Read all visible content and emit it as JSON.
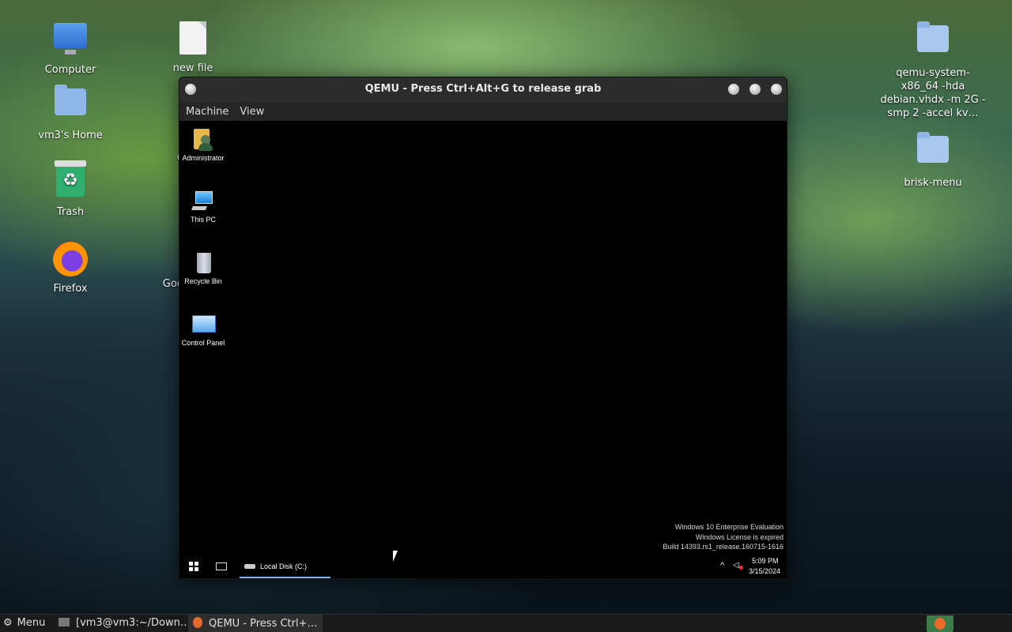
{
  "desktop": {
    "icons_left": [
      {
        "label": "Computer",
        "icon": "computer-icon"
      },
      {
        "label": "vm3's Home",
        "icon": "home-folder-icon"
      },
      {
        "label": "Trash",
        "icon": "trash-icon"
      },
      {
        "label": "Firefox",
        "icon": "firefox-icon"
      }
    ],
    "icons_mid": [
      {
        "label": "new file",
        "icon": "file-icon"
      },
      {
        "label": "de",
        "icon": "partial-icon"
      },
      {
        "label": "Goog",
        "icon": "partial-icon"
      }
    ],
    "icons_right": [
      {
        "label": "qemu-system-x86_64 -hda debian.vhdx -m 2G -smp 2 -accel kv…",
        "icon": "folder-icon"
      },
      {
        "label": "brisk-menu",
        "icon": "folder-icon"
      }
    ]
  },
  "qemu": {
    "title": "QEMU - Press Ctrl+Alt+G to release grab",
    "menu": [
      "Machine",
      "View"
    ],
    "guest": {
      "icons": [
        {
          "label": "Administrator"
        },
        {
          "label": "This PC"
        },
        {
          "label": "Recycle Bin"
        },
        {
          "label": "Control Panel"
        }
      ],
      "watermark": [
        "Windows 10 Enterprise Evaluation",
        "Windows License is expired",
        "Build 14393.rs1_release.160715-1616"
      ],
      "taskbar": {
        "app_label": "Local Disk (C:)",
        "time": "5:09 PM",
        "date": "3/15/2024"
      }
    }
  },
  "host_taskbar": {
    "menu_label": "Menu",
    "items": [
      {
        "label": "[vm3@vm3:~/Down…"
      },
      {
        "label": "QEMU - Press Ctrl+…"
      }
    ]
  }
}
